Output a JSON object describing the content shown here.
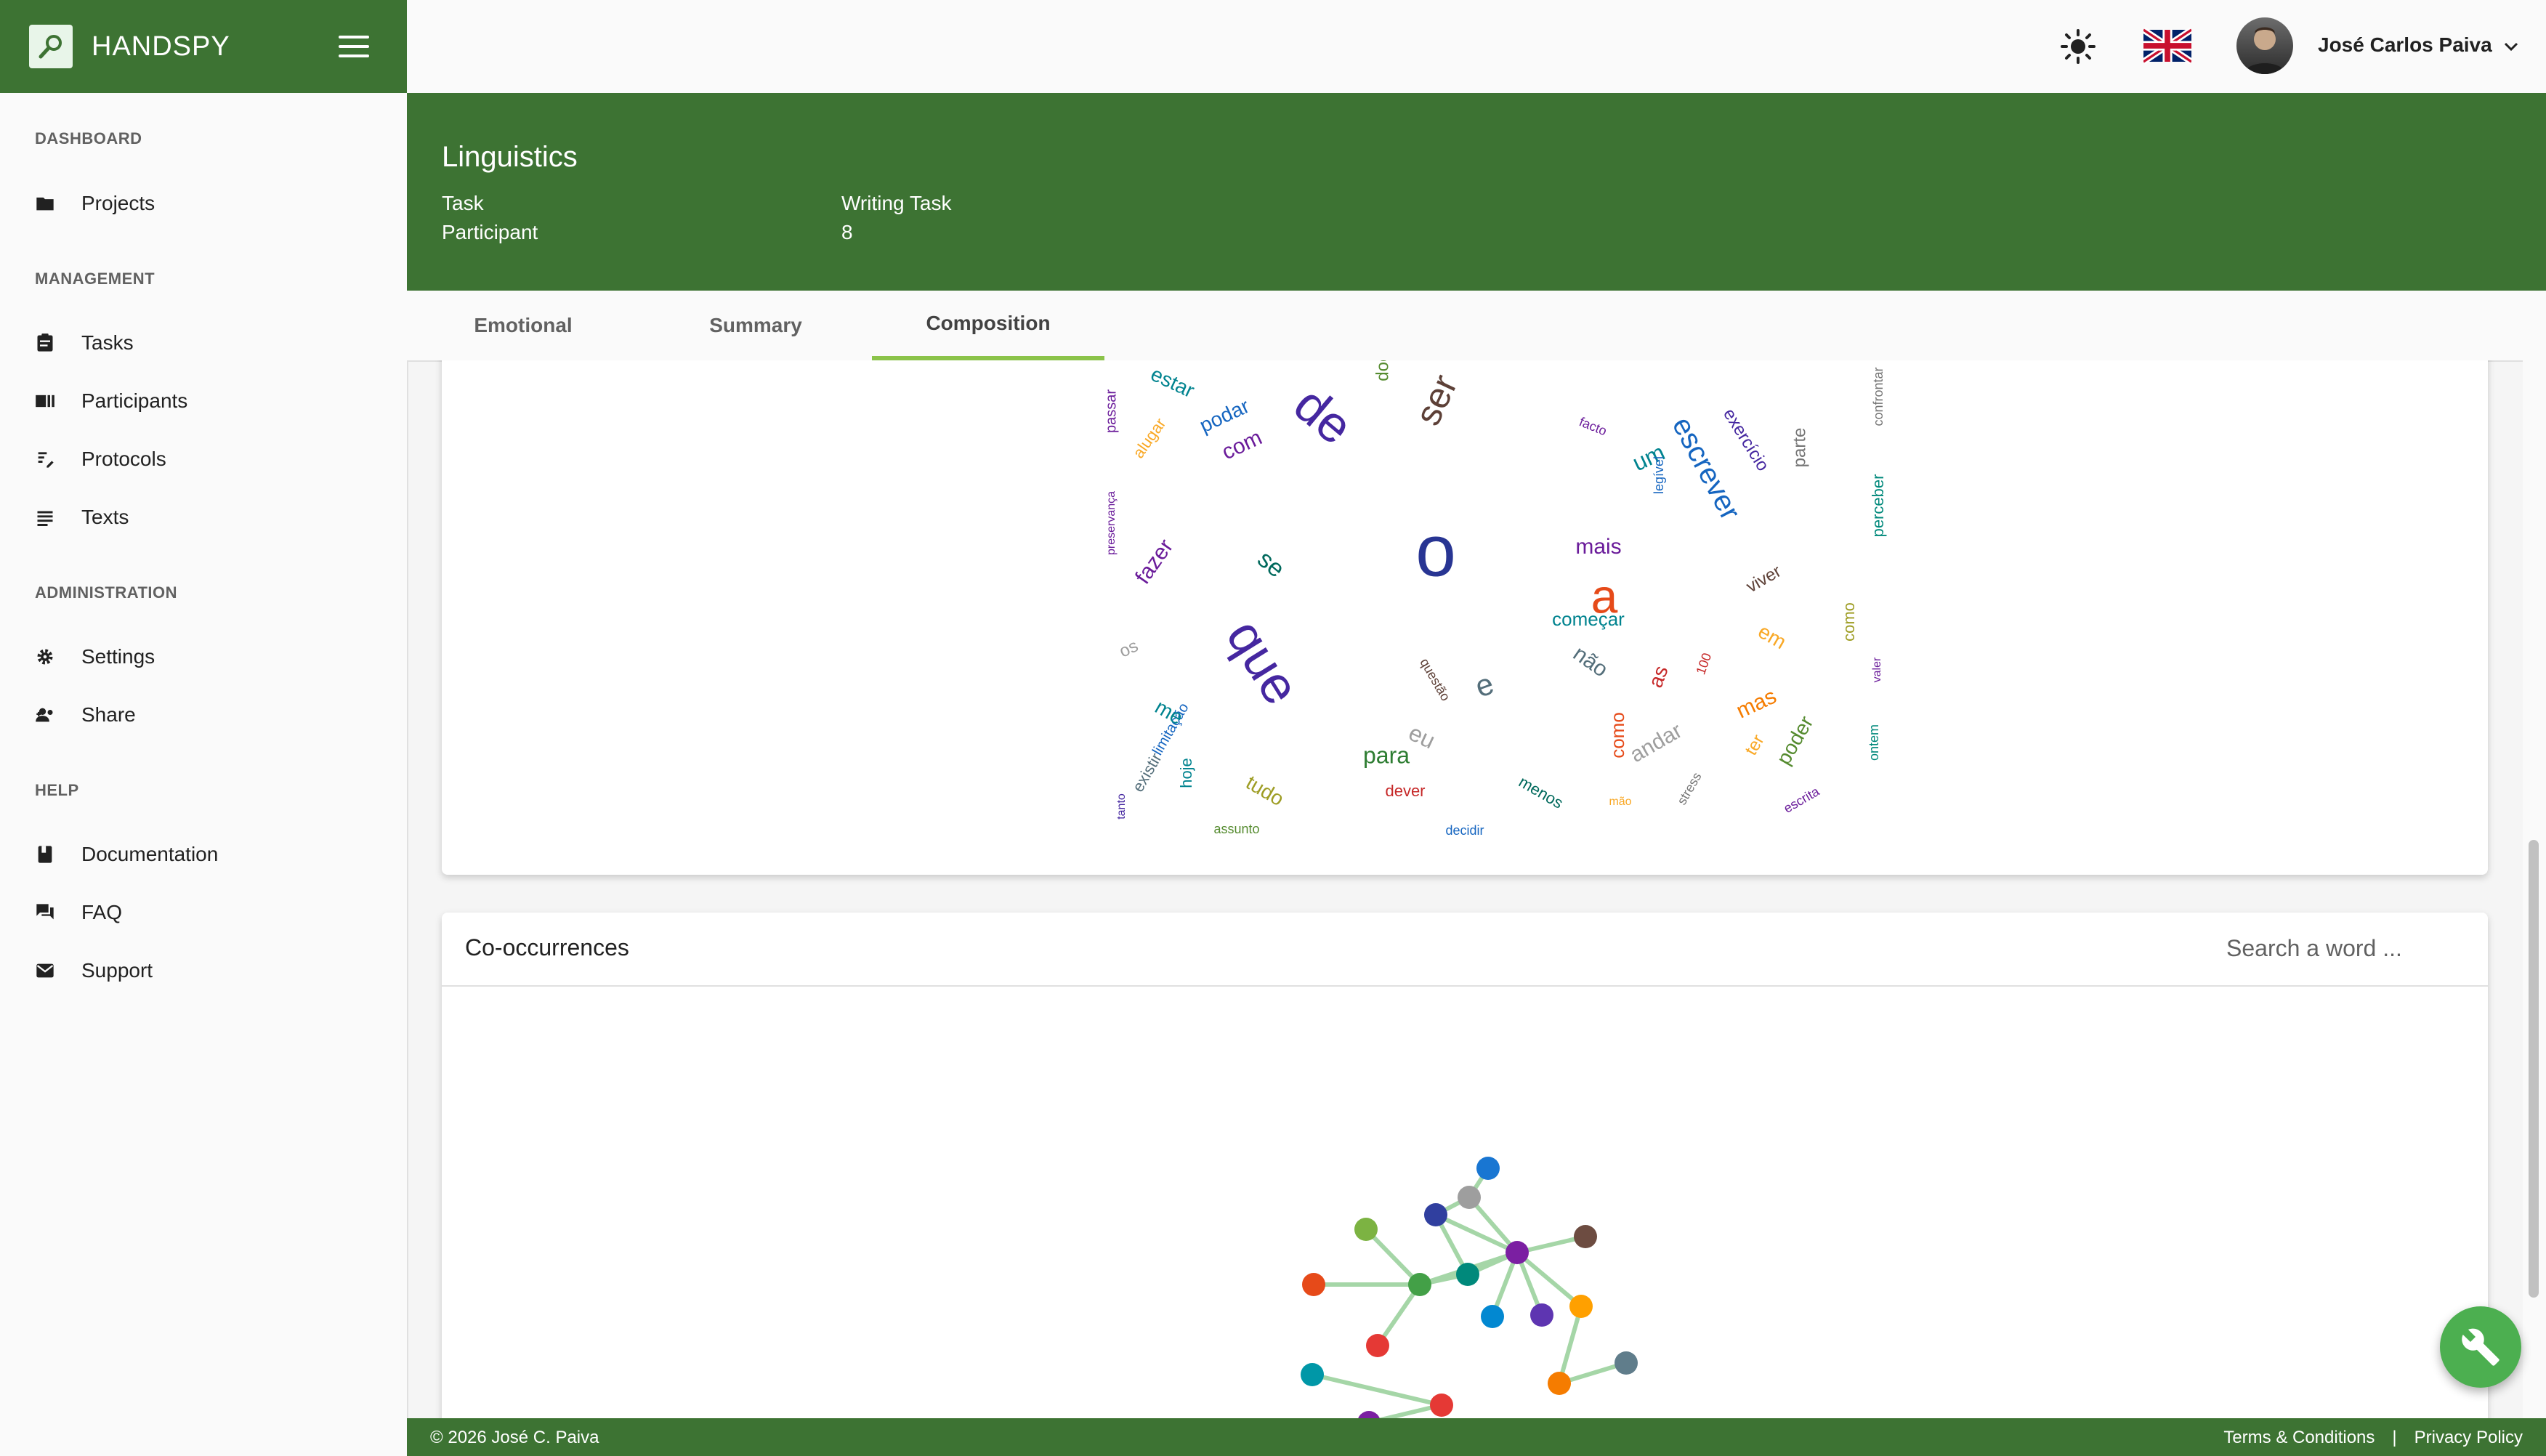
{
  "brand": {
    "title": "HANDSPY"
  },
  "sidebar": {
    "sections": [
      {
        "label": "DASHBOARD",
        "items": [
          {
            "label": "Projects",
            "icon": "folder-icon"
          }
        ]
      },
      {
        "label": "MANAGEMENT",
        "items": [
          {
            "label": "Tasks",
            "icon": "clipboard-icon"
          },
          {
            "label": "Participants",
            "icon": "participants-icon"
          },
          {
            "label": "Protocols",
            "icon": "protocols-icon"
          },
          {
            "label": "Texts",
            "icon": "text-lines-icon"
          }
        ]
      },
      {
        "label": "ADMINISTRATION",
        "items": [
          {
            "label": "Settings",
            "icon": "gear-icon"
          },
          {
            "label": "Share",
            "icon": "share-people-icon"
          }
        ]
      },
      {
        "label": "HELP",
        "items": [
          {
            "label": "Documentation",
            "icon": "book-icon"
          },
          {
            "label": "FAQ",
            "icon": "chat-icon"
          },
          {
            "label": "Support",
            "icon": "envelope-icon"
          }
        ]
      }
    ]
  },
  "topbar": {
    "user_name": "José Carlos Paiva",
    "theme_icon": "sun-icon",
    "language_icon": "uk-flag-icon"
  },
  "header": {
    "title": "Linguistics",
    "task_label": "Task",
    "task_value": "Writing Task",
    "participant_label": "Participant",
    "participant_value": "8"
  },
  "tabs": [
    {
      "label": "Emotional",
      "active": false
    },
    {
      "label": "Summary",
      "active": false
    },
    {
      "label": "Composition",
      "active": true
    }
  ],
  "word_cloud": {
    "words": [
      {
        "text": "estar",
        "color": "#00838f"
      },
      {
        "text": "passar",
        "color": "#6a1b9a"
      },
      {
        "text": "alugar",
        "color": "#f9a825"
      },
      {
        "text": "podar",
        "color": "#1565c0"
      },
      {
        "text": "com",
        "color": "#6a1b9a"
      },
      {
        "text": "de",
        "color": "#4527a0"
      },
      {
        "text": "doente",
        "color": "#558b2f"
      },
      {
        "text": "ser",
        "color": "#5d4037"
      },
      {
        "text": "facto",
        "color": "#6a1b9a"
      },
      {
        "text": "um",
        "color": "#00838f"
      },
      {
        "text": "legível",
        "color": "#1565c0"
      },
      {
        "text": "escrever",
        "color": "#1565c0"
      },
      {
        "text": "exercício",
        "color": "#4527a0"
      },
      {
        "text": "parte",
        "color": "#757575"
      },
      {
        "text": "confrontar",
        "color": "#757575"
      },
      {
        "text": "perceber",
        "color": "#00897b"
      },
      {
        "text": "preservança",
        "color": "#6a1b9a"
      },
      {
        "text": "fazer",
        "color": "#6a1b9a"
      },
      {
        "text": "se",
        "color": "#00695c"
      },
      {
        "text": "o",
        "color": "#283593"
      },
      {
        "text": "mais",
        "color": "#6a1b9a"
      },
      {
        "text": "a",
        "color": "#e64a19"
      },
      {
        "text": "viver",
        "color": "#5d4037"
      },
      {
        "text": "começar",
        "color": "#00838f"
      },
      {
        "text": "em",
        "color": "#f9a825"
      },
      {
        "text": "como",
        "color": "#9e9d24"
      },
      {
        "text": "os",
        "color": "#9e9e9e"
      },
      {
        "text": "que",
        "color": "#4527a0"
      },
      {
        "text": "não",
        "color": "#546e7a"
      },
      {
        "text": "questão",
        "color": "#5d4037"
      },
      {
        "text": "e",
        "color": "#546e7a"
      },
      {
        "text": "as",
        "color": "#c62828"
      },
      {
        "text": "100",
        "color": "#c62828"
      },
      {
        "text": "valer",
        "color": "#6a1b9a"
      },
      {
        "text": "mas",
        "color": "#f57c00"
      },
      {
        "text": "limitação",
        "color": "#1565c0"
      },
      {
        "text": "me",
        "color": "#00838f"
      },
      {
        "text": "eu",
        "color": "#9e9e9e"
      },
      {
        "text": "como",
        "color": "#e64a19"
      },
      {
        "text": "andar",
        "color": "#9e9e9e"
      },
      {
        "text": "ter",
        "color": "#f9a825"
      },
      {
        "text": "poder",
        "color": "#558b2f"
      },
      {
        "text": "ontem",
        "color": "#00897b"
      },
      {
        "text": "existir",
        "color": "#546e7a"
      },
      {
        "text": "hoje",
        "color": "#00838f"
      },
      {
        "text": "tudo",
        "color": "#9e9d24"
      },
      {
        "text": "para",
        "color": "#2e7d32"
      },
      {
        "text": "tanto",
        "color": "#4527a0"
      },
      {
        "text": "dever",
        "color": "#c62828"
      },
      {
        "text": "menos",
        "color": "#00695c"
      },
      {
        "text": "stress",
        "color": "#757575"
      },
      {
        "text": "escrita",
        "color": "#6a1b9a"
      },
      {
        "text": "mão",
        "color": "#f9a825"
      },
      {
        "text": "assunto",
        "color": "#558b2f"
      },
      {
        "text": "decidir",
        "color": "#1565c0"
      }
    ]
  },
  "cooccurrences": {
    "title": "Co-occurrences",
    "search_placeholder": "Search a word ...",
    "node_colors": [
      "#1976d2",
      "#9e9e9e",
      "#303f9f",
      "#6d4c41",
      "#7cb342",
      "#7b1fa2",
      "#00897b",
      "#e64a19",
      "#43a047",
      "#ffa000",
      "#0288d1",
      "#5e35b1",
      "#e53935",
      "#0097a7",
      "#f57c00",
      "#607d8b"
    ],
    "edge_color": "#a5d6a7"
  },
  "footer": {
    "copyright": "© 2026 José C. Paiva",
    "terms": "Terms & Conditions",
    "separator": "|",
    "privacy": "Privacy Policy"
  }
}
